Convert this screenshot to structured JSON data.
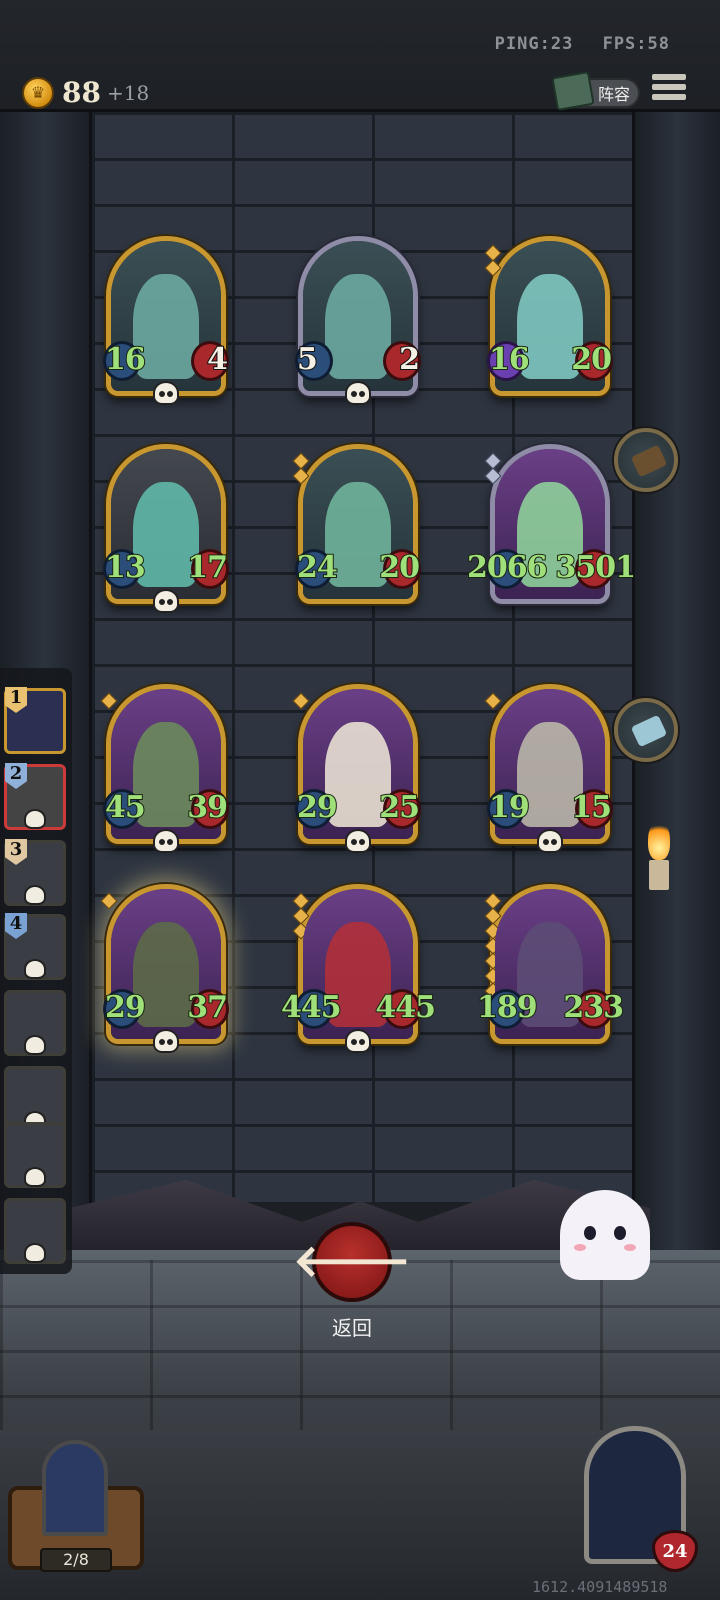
{
  "network": {
    "ping": "PING:23",
    "fps": "FPS:58"
  },
  "gold": {
    "value": "88",
    "income": "+18"
  },
  "lineup_button": {
    "label": "阵容"
  },
  "cards": [
    {
      "atk": "16",
      "hp": "4"
    },
    {
      "atk": "5",
      "hp": "2"
    },
    {
      "atk": "16",
      "hp": "20"
    },
    {
      "atk": "13",
      "hp": "17"
    },
    {
      "atk": "24",
      "hp": "20"
    },
    {
      "atk": "2066",
      "hp": "3501"
    },
    {
      "atk": "45",
      "hp": "39"
    },
    {
      "atk": "29",
      "hp": "25"
    },
    {
      "atk": "19",
      "hp": "15"
    },
    {
      "atk": "29",
      "hp": "37"
    },
    {
      "atk": "445",
      "hp": "445"
    },
    {
      "atk": "189",
      "hp": "233"
    }
  ],
  "queue": [
    "1",
    "2",
    "3",
    "4"
  ],
  "back_button": {
    "label": "返回"
  },
  "chest": {
    "count": "2/8"
  },
  "hero": {
    "hp": "24"
  },
  "footer_id": "1612.4091489518"
}
